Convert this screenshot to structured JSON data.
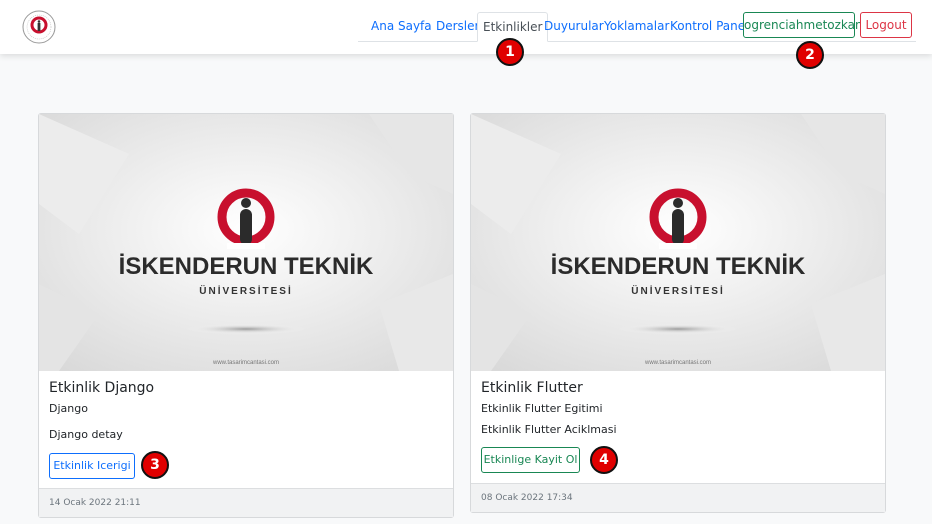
{
  "navbar": {
    "logo_icon": "university-logo-icon",
    "links": [
      {
        "label": "Ana Sayfa"
      },
      {
        "label": "Dersler"
      },
      {
        "label": "Etkinlikler",
        "active": true
      },
      {
        "label": "Duyurular"
      },
      {
        "label": "Yoklamalar"
      },
      {
        "label": "Kontrol Paneli"
      }
    ],
    "user_label": "ogrenciahmetozkan",
    "logout_label": "Logout"
  },
  "annotations": [
    "1",
    "2",
    "3",
    "4"
  ],
  "cards": [
    {
      "image_brand": "İSKENDERUN TEKNİK",
      "image_sub": "ÜNİVERSİTESİ",
      "image_url_text": "www.tasarimcantasi.com",
      "title": "Etkinlik Django",
      "subtitle": "Django",
      "detail": "Django detay",
      "button_label": "Etkinlik Icerigi",
      "footer": "14 Ocak 2022 21:11"
    },
    {
      "image_brand": "İSKENDERUN TEKNİK",
      "image_sub": "ÜNİVERSİTESİ",
      "image_url_text": "www.tasarimcantasi.com",
      "title": "Etkinlik Flutter",
      "subtitle": "Etkinlik Flutter Egitimi",
      "detail": "Etkinlik Flutter Aciklmasi",
      "button_label": "Etkinlige Kayit Ol",
      "footer": "08 Ocak 2022 17:34"
    }
  ],
  "colors": {
    "primary": "#0d6efd",
    "success": "#198754",
    "danger": "#dc3545",
    "brand_red": "#c8102e",
    "badge_red": "#e00000"
  }
}
